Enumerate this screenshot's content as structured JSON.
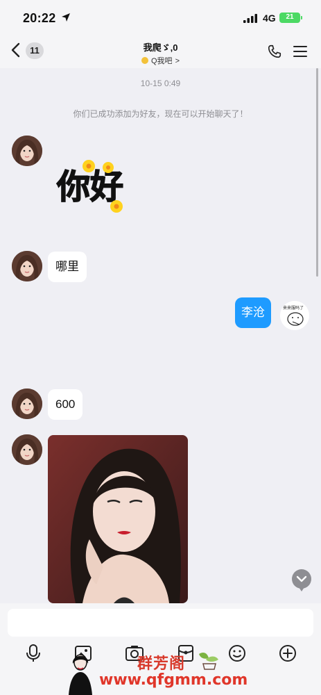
{
  "status_bar": {
    "time": "20:22",
    "network": "4G",
    "battery": "21"
  },
  "header": {
    "unread_count": "11",
    "title": "我爬ゞ,0",
    "subtitle": "Q我吧",
    "subtitle_chevron": ">"
  },
  "chat": {
    "timestamp": "10-15 0:49",
    "system_note": "你们已成功添加为好友，现在可以开始聊天了！",
    "sticker_text": "你好",
    "messages": [
      {
        "from": "them",
        "type": "sticker",
        "text": "你好"
      },
      {
        "from": "them",
        "type": "text",
        "text": "哪里"
      },
      {
        "from": "me",
        "type": "text",
        "text": "李沧"
      },
      {
        "from": "them",
        "type": "text",
        "text": "600"
      },
      {
        "from": "them",
        "type": "image"
      }
    ],
    "mini_sticker_text": "来来服吗了"
  },
  "input": {
    "placeholder": "",
    "tools": [
      "microphone-icon",
      "image-icon",
      "camera-icon",
      "red-packet-icon",
      "emoji-icon",
      "plus-icon"
    ]
  },
  "watermark": {
    "name": "群芳阁",
    "url": "www.qfgmm.com"
  },
  "colors": {
    "my_bubble": "#1e9bff",
    "their_bubble": "#ffffff",
    "background": "#efeff4",
    "watermark": "#e0362a"
  }
}
